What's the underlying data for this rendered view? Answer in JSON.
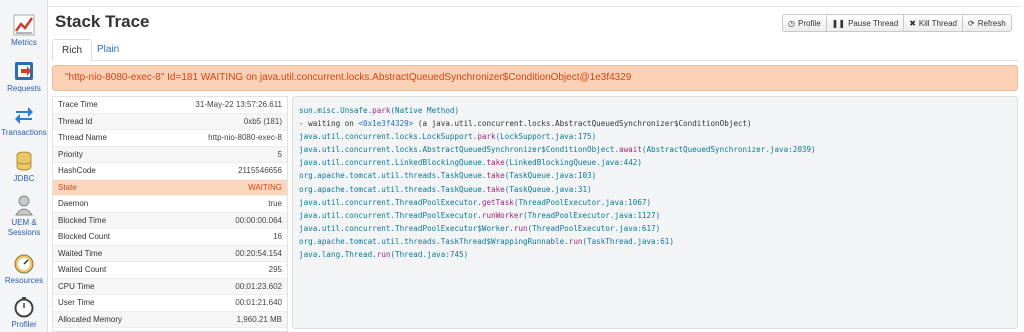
{
  "sidebar": {
    "items": [
      {
        "label": "Metrics"
      },
      {
        "label": "Requests"
      },
      {
        "label": "Transactions"
      },
      {
        "label": "JDBC"
      },
      {
        "label": "UEM &"
      },
      {
        "label": "Sessions"
      },
      {
        "label": "Resources"
      },
      {
        "label": "Profiler"
      }
    ]
  },
  "header": {
    "title": "Stack Trace",
    "buttons": [
      {
        "label": "Profile",
        "icon": "clock-icon"
      },
      {
        "label": "Pause Thread",
        "icon": "pause-icon"
      },
      {
        "label": "Kill Thread",
        "icon": "x-icon"
      },
      {
        "label": "Refresh",
        "icon": "refresh-icon"
      }
    ]
  },
  "tabs": [
    {
      "label": "Rich",
      "active": true
    },
    {
      "label": "Plain",
      "active": false
    }
  ],
  "banner": "\"http-nio-8080-exec-8\" Id=181 WAITING on java.util.concurrent.locks.AbstractQueuedSynchronizer$ConditionObject@1e3f4329",
  "info_rows": [
    {
      "key": "Trace Time",
      "value": "31-May-22 13:57:26.611"
    },
    {
      "key": "Thread Id",
      "value": "0xb5 (181)"
    },
    {
      "key": "Thread Name",
      "value": "http-nio-8080-exec-8"
    },
    {
      "key": "Priority",
      "value": "5"
    },
    {
      "key": "HashCode",
      "value": "2115546656"
    },
    {
      "key": "State",
      "value": "WAITING"
    },
    {
      "key": "Daemon",
      "value": "true"
    },
    {
      "key": "Blocked Time",
      "value": "00:00:00.064"
    },
    {
      "key": "Blocked Count",
      "value": "16"
    },
    {
      "key": "Waited Time",
      "value": "00:20:54.154"
    },
    {
      "key": "Waited Count",
      "value": "295"
    },
    {
      "key": "CPU Time",
      "value": "00:01:23.602"
    },
    {
      "key": "User Time",
      "value": "00:01:21.640"
    },
    {
      "key": "Allocated Memory",
      "value": "1,960.21 MB"
    }
  ],
  "trace": [
    {
      "cls": "sun.misc.Unsafe.",
      "method": "park",
      "src": "(Native Method)"
    },
    {
      "wait_prefix": "- waiting on ",
      "addr": "<0x1e3f4329>",
      "wait_suffix": " (a java.util.concurrent.locks.AbstractQueuedSynchronizer$ConditionObject)"
    },
    {
      "cls": "java.util.concurrent.locks.LockSupport.",
      "method": "park",
      "src": "(LockSupport.java:175)"
    },
    {
      "cls": "java.util.concurrent.locks.AbstractQueuedSynchronizer$ConditionObject.",
      "method": "await",
      "src": "(AbstractQueuedSynchronizer.java:2039)"
    },
    {
      "cls": "java.util.concurrent.LinkedBlockingQueue.",
      "method": "take",
      "src": "(LinkedBlockingQueue.java:442)"
    },
    {
      "cls": "org.apache.tomcat.util.threads.TaskQueue.",
      "method": "take",
      "src": "(TaskQueue.java:103)"
    },
    {
      "cls": "org.apache.tomcat.util.threads.TaskQueue.",
      "method": "take",
      "src": "(TaskQueue.java:31)"
    },
    {
      "cls": "java.util.concurrent.ThreadPoolExecutor.",
      "method": "getTask",
      "src": "(ThreadPoolExecutor.java:1067)"
    },
    {
      "cls": "java.util.concurrent.ThreadPoolExecutor.",
      "method": "runWorker",
      "src": "(ThreadPoolExecutor.java:1127)"
    },
    {
      "cls": "java.util.concurrent.ThreadPoolExecutor$Worker.",
      "method": "run",
      "src": "(ThreadPoolExecutor.java:617)"
    },
    {
      "cls": "org.apache.tomcat.util.threads.TaskThread$WrappingRunnable.",
      "method": "run",
      "src": "(TaskThread.java:61)"
    },
    {
      "cls": "java.lang.Thread.",
      "method": "run",
      "src": "(Thread.java:745)"
    }
  ],
  "colors": {
    "alert_text": "#d2451a",
    "alert_bg": "#fcd1b5",
    "method": "#9c2b7e",
    "class": "#0a7a96",
    "link": "#2a6fc0"
  }
}
